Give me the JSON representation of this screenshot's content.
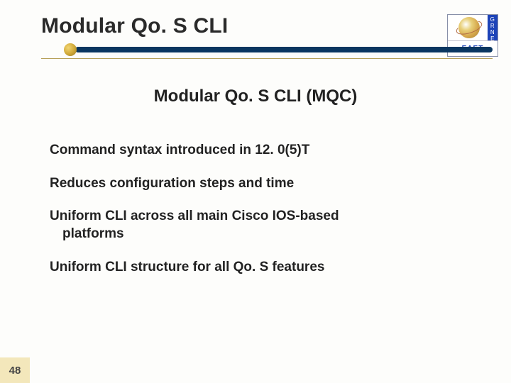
{
  "title": "Modular Qo. S CLI",
  "subhead": "Modular Qo. S CLI (MQC)",
  "bullets": [
    "Command syntax introduced in 12. 0(5)T",
    "Reduces configuration steps and time",
    "Uniform CLI across all main Cisco IOS-based platforms",
    "Uniform CLI structure for all Qo. S features"
  ],
  "page_number": "48",
  "logo": {
    "side_text": "GRNET",
    "bottom_text": "ΕΔΕΤ"
  }
}
